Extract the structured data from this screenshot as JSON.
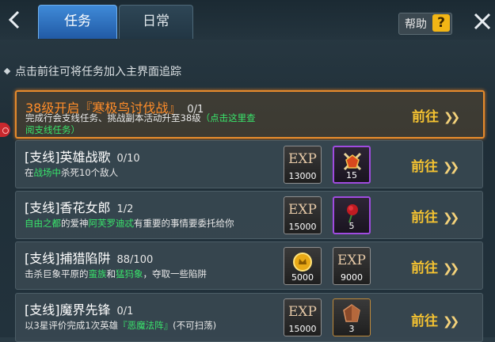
{
  "header": {
    "tabs": [
      {
        "label": "任务",
        "active": true
      },
      {
        "label": "日常",
        "active": false
      }
    ],
    "help_label": "帮助",
    "help_icon": "?"
  },
  "hint": "点击前往可将任务加入主界面追踪",
  "quests": [
    {
      "title": "38级开启『寒极鸟讨伐战』",
      "count": "0/1",
      "desc_line1": "完成行会支线任务、挑战副本活动升至38级",
      "desc_link1": "（点击这里查",
      "desc_link2": "阅支线任务）",
      "goto": "前往",
      "selected": true
    },
    {
      "title": "[支线]英雄战歌",
      "count": "0/10",
      "desc_pre": "在",
      "desc_green": "战场中",
      "desc_post": "杀死10个敌人",
      "goto": "前往",
      "rewards": [
        {
          "type": "exp",
          "label": "EXP",
          "amount": "13000"
        },
        {
          "type": "sword-emblem-icon",
          "amount": "15"
        }
      ]
    },
    {
      "title": "[支线]香花女郎",
      "count": "1/2",
      "desc_green1": "自由之都",
      "desc_mid1": "的爱神",
      "desc_green2": "阿芙罗迪忒",
      "desc_post": "有重要的事情要委托给你",
      "goto": "前往",
      "rewards": [
        {
          "type": "exp",
          "label": "EXP",
          "amount": "15000"
        },
        {
          "type": "rose-icon",
          "amount": "5"
        }
      ]
    },
    {
      "title": "[支线]捕猎陷阱",
      "count": "88/100",
      "desc_pre": "击杀巨象平原的",
      "desc_green1": "蛮族",
      "desc_mid": "和",
      "desc_green2": "猛犸象",
      "desc_post": "，夺取一些陷阱",
      "goto": "前往",
      "rewards": [
        {
          "type": "gold-coin-icon",
          "amount": "5000"
        },
        {
          "type": "exp",
          "label": "EXP",
          "amount": "9000"
        }
      ]
    },
    {
      "title": "[支线]魔界先锋",
      "count": "0/1",
      "desc_pre": "以3星评价完成1次英雄",
      "desc_green": "『恶魔法阵』",
      "desc_post": "(不可扫荡)",
      "goto": "前往",
      "rewards": [
        {
          "type": "exp",
          "label": "EXP",
          "amount": "15000"
        },
        {
          "type": "ore-crystal-icon",
          "amount": "3"
        }
      ]
    }
  ],
  "colors": {
    "accent_orange": "#e58a2c",
    "goto_gold": "#f4c231",
    "green_text": "#39e46b",
    "tab_blue": "#2f73c0"
  }
}
